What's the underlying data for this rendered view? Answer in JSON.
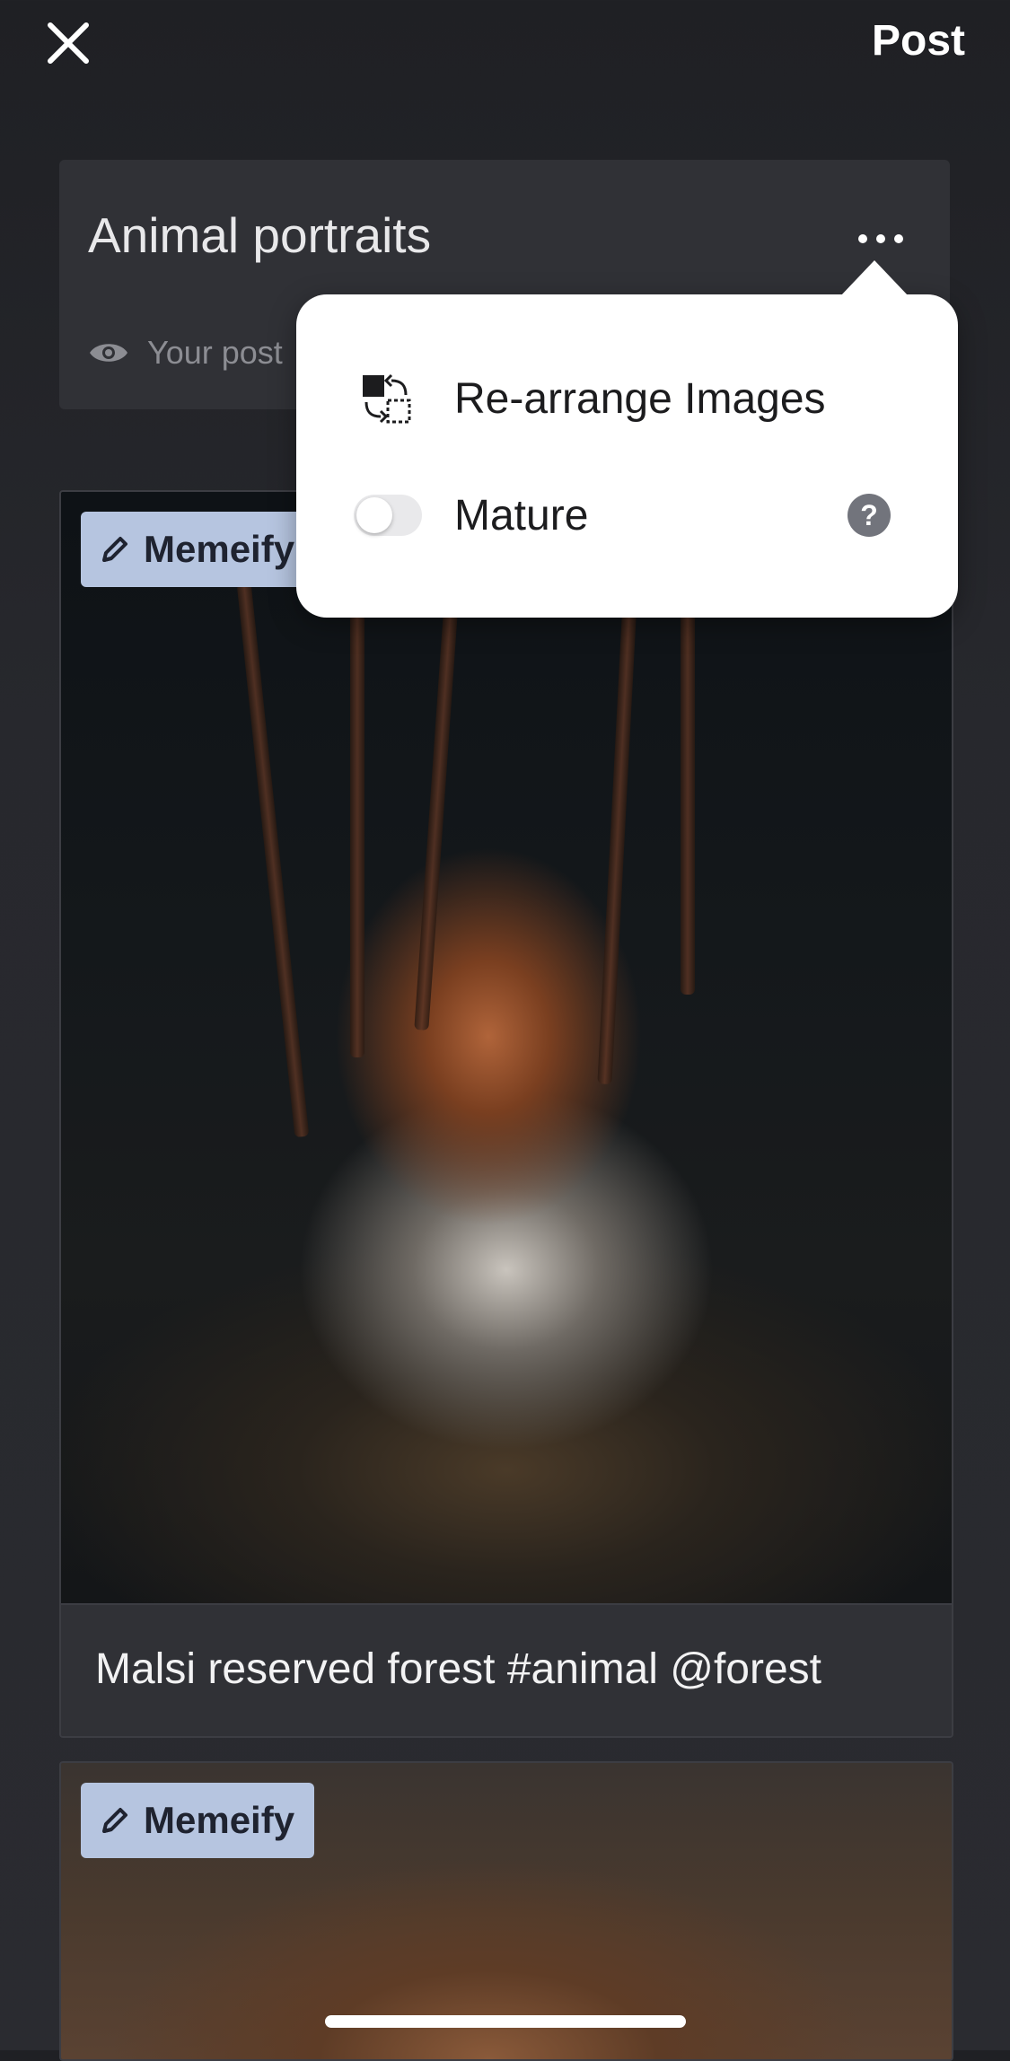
{
  "topbar": {
    "close_icon": "close-x-icon",
    "post_label": "Post"
  },
  "post": {
    "title": "Animal portraits",
    "more_icon": "more-horizontal-icon",
    "visibility_icon": "eye-icon",
    "visibility_text": "Your post"
  },
  "menu": {
    "rearrange": {
      "icon": "rearrange-images-icon",
      "label": "Re-arrange Images"
    },
    "mature": {
      "label": "Mature",
      "toggle_on": false,
      "help_icon": "question-mark-icon",
      "help_glyph": "?"
    }
  },
  "images": [
    {
      "memeify_icon": "pencil-icon",
      "memeify_label": "Memeify",
      "caption": "Malsi reserved forest #animal @forest"
    },
    {
      "memeify_icon": "pencil-icon",
      "memeify_label": "Memeify"
    }
  ],
  "colors": {
    "background": "#27282d",
    "card": "#303136",
    "memeify_bg": "#b6c5e0",
    "popup_bg": "#ffffff",
    "help_icon": "#72747c"
  }
}
